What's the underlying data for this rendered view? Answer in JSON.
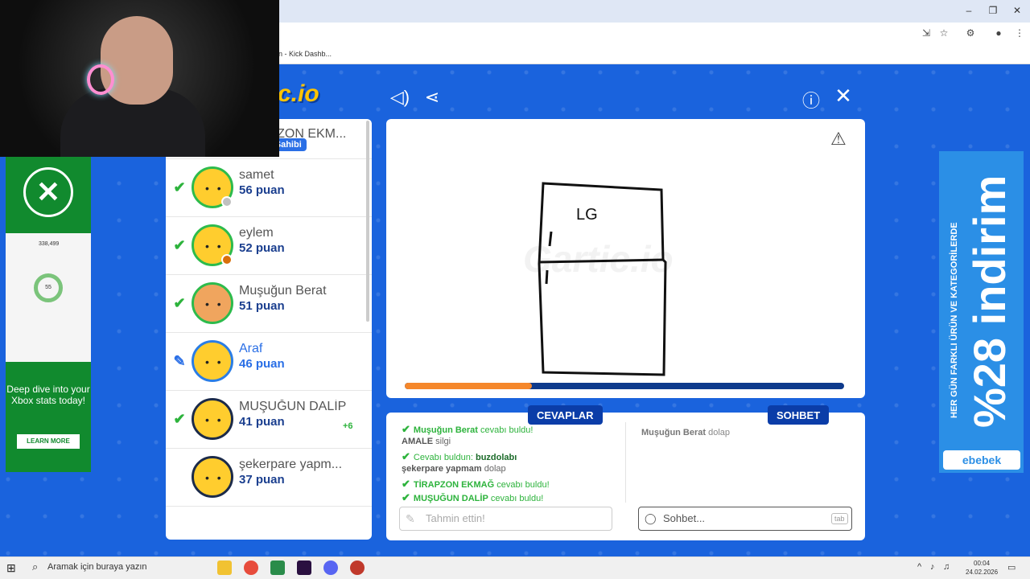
{
  "browser": {
    "bookmark_item": "n - Kick Dashb...",
    "win_controls": [
      "–",
      "❐",
      "✕"
    ]
  },
  "game": {
    "logo_text": "c.io",
    "players": [
      {
        "name": "TİRAPZON EKM...",
        "score": "",
        "badge": "Oda Sahibi",
        "status": "",
        "ring": "green",
        "dot": "#f3c400"
      },
      {
        "name": "samet",
        "score": "56 puan",
        "status": "check",
        "ring": "green",
        "dot": "#c0c0c0"
      },
      {
        "name": "eylem",
        "score": "52 puan",
        "status": "check",
        "ring": "green",
        "dot": "#d9700b"
      },
      {
        "name": "Muşuğun Berat",
        "score": "51 puan",
        "status": "check",
        "ring": "green",
        "dot": ""
      },
      {
        "name": "Araf",
        "score": "46 puan",
        "status": "pen",
        "ring": "blue",
        "dot": ""
      },
      {
        "name": "MUŞUĞUN DALİP",
        "score": "41 puan",
        "bonus": "+6",
        "status": "check",
        "ring": "dark",
        "dot": ""
      },
      {
        "name": "şekerpare yapm...",
        "score": "37 puan",
        "status": "",
        "ring": "dark",
        "dot": ""
      }
    ],
    "canvas": {
      "drawing_text": "LG",
      "watermark": "Gartic.io",
      "progress": 0.29,
      "progress_color": "#f5872b"
    },
    "answers": {
      "tab_label": "CEVAPLAR",
      "lines": [
        {
          "type": "found",
          "name": "Muşuğun Berat",
          "suffix": "cevabı buldu!"
        },
        {
          "type": "guess",
          "name": "AMALE",
          "text": "silgi"
        },
        {
          "type": "answer",
          "prefix": "Cevabı buldun:",
          "text": "buzdolabı"
        },
        {
          "type": "guess",
          "name": "şekerpare yapmam",
          "text": "dolap"
        },
        {
          "type": "found",
          "name": "TİRAPZON EKMAĞ",
          "suffix": "cevabı buldu!"
        },
        {
          "type": "found",
          "name": "MUŞUĞUN DALİP",
          "suffix": "cevabı buldu!"
        }
      ],
      "input_placeholder": "Tahmin ettin!"
    },
    "chat": {
      "tab_label": "SOHBET",
      "lines": [
        {
          "name": "Muşuğun Berat",
          "text": "dolap"
        }
      ],
      "input_placeholder": "Sohbet...",
      "tab_key": "tab"
    }
  },
  "ads": {
    "left": {
      "stat1": "338,499",
      "stat2": "55",
      "text": "Deep dive into your Xbox stats today!",
      "button": "LEARN MORE"
    },
    "right": {
      "small": "HER GÜN FARKLI ÜRÜN VE KATEGORİLERDE",
      "big": "%28 indirim",
      "brand": "ebebek"
    }
  },
  "taskbar": {
    "search_placeholder": "Aramak için buraya yazın",
    "time": "00:04",
    "date": "24.02.2026"
  }
}
